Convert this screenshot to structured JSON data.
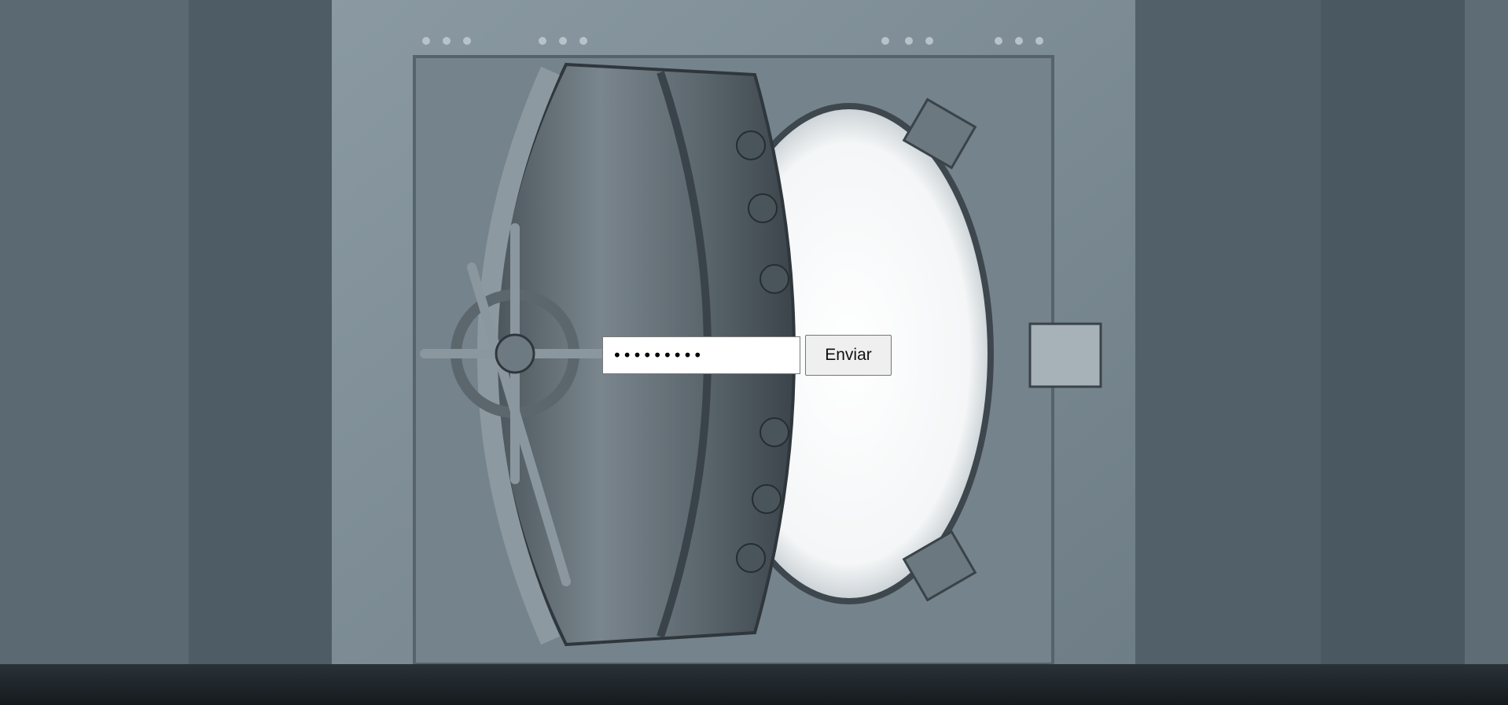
{
  "background": {
    "scene": "bank-vault-door",
    "wall_color": "#4f5d66",
    "floor_color": "#1e252a",
    "frame_color": "#7d8c95",
    "door_color": "#5e6a72",
    "light_color": "#ffffff"
  },
  "form": {
    "password_value": "secret123",
    "submit_label": "Enviar"
  }
}
